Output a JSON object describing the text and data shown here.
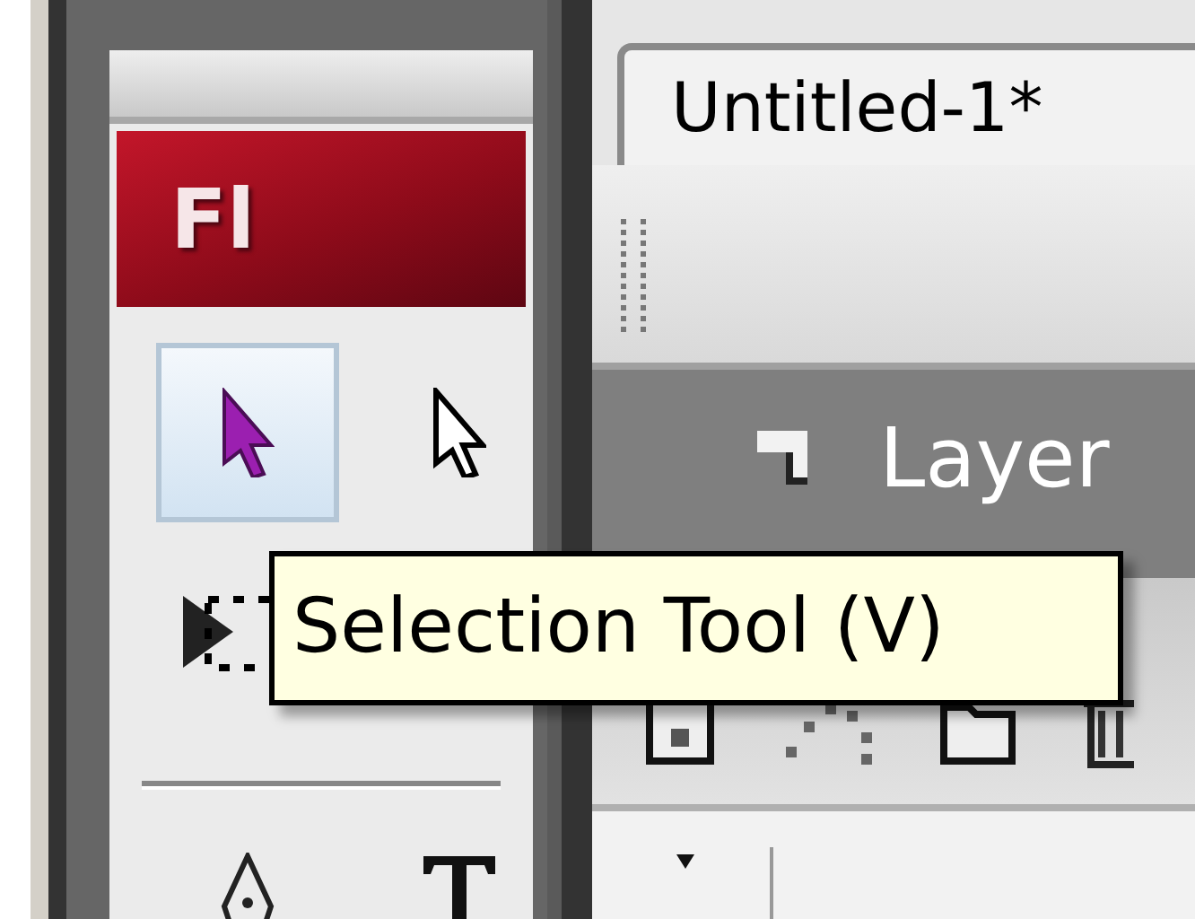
{
  "tools_panel": {
    "logo": "Fl",
    "tool_groups": [
      [
        {
          "kind": "selection",
          "selected": true
        },
        {
          "kind": "subselection",
          "selected": false
        },
        {
          "kind": "free-transform",
          "selected": false
        }
      ],
      [
        {
          "kind": "pen",
          "selected": false
        },
        {
          "kind": "text",
          "selected": false
        }
      ]
    ]
  },
  "tooltip": "Selection Tool (V)",
  "document_tab": {
    "title": "Untitled-1*",
    "selected": true
  },
  "layers_panel": {
    "title": "Layer"
  }
}
